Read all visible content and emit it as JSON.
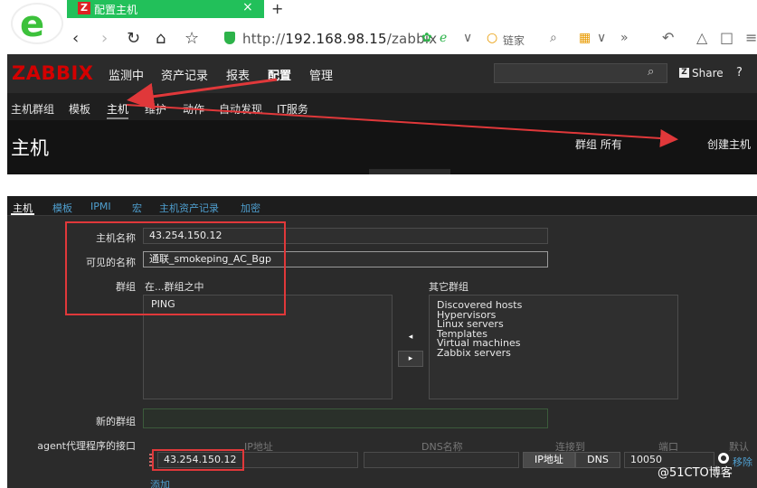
{
  "browser": {
    "tab_title": "配置主机",
    "tab_close": "×",
    "tab_plus": "+",
    "url_prefix": "http://",
    "url_host": "192.168.98.15",
    "url_path": "/zabbix",
    "search_hint": "链家",
    "chevrons": "»"
  },
  "header": {
    "logo": "ZABBIX",
    "menu": [
      "监测中",
      "资产记录",
      "报表",
      "配置",
      "管理"
    ],
    "share": "Share",
    "share_z": "Z",
    "help": "?"
  },
  "submenu": [
    "主机群组",
    "模板",
    "主机",
    "维护",
    "动作",
    "自动发现",
    "IT服务"
  ],
  "page": {
    "title": "主机",
    "group_filter": "群组 所有",
    "create_button": "创建主机"
  },
  "form": {
    "tabs": [
      "主机",
      "模板",
      "IPMI",
      "宏",
      "主机资产记录",
      "加密"
    ],
    "host_name_label": "主机名称",
    "host_name_value": "43.254.150.12",
    "visible_name_label": "可见的名称",
    "visible_name_value": "通联_smokeping_AC_Bgp",
    "groups_label": "群组",
    "in_groups_label": "在...群组之中",
    "other_groups_label": "其它群组",
    "in_groups": [
      "PING"
    ],
    "other_groups": [
      "Discovered hosts",
      "Hypervisors",
      "Linux servers",
      "Templates",
      "Virtual machines",
      "Zabbix servers"
    ],
    "move_left": "◂",
    "move_right": "▸",
    "new_group_label": "新的群组",
    "agent_label": "agent代理程序的接口",
    "col_ip": "IP地址",
    "col_dns": "DNS名称",
    "col_connect": "连接到",
    "col_port": "端口",
    "col_default": "默认",
    "agent_ip": "43.254.150.12",
    "connect_ip": "IP地址",
    "connect_dns": "DNS",
    "port": "10050",
    "remove": "移除",
    "add": "添加"
  },
  "watermark": "@51CTO博客",
  "colors": {
    "accent_red": "#e0383a",
    "zabbix_red": "#d40000",
    "link_blue": "#4f9fcf"
  }
}
